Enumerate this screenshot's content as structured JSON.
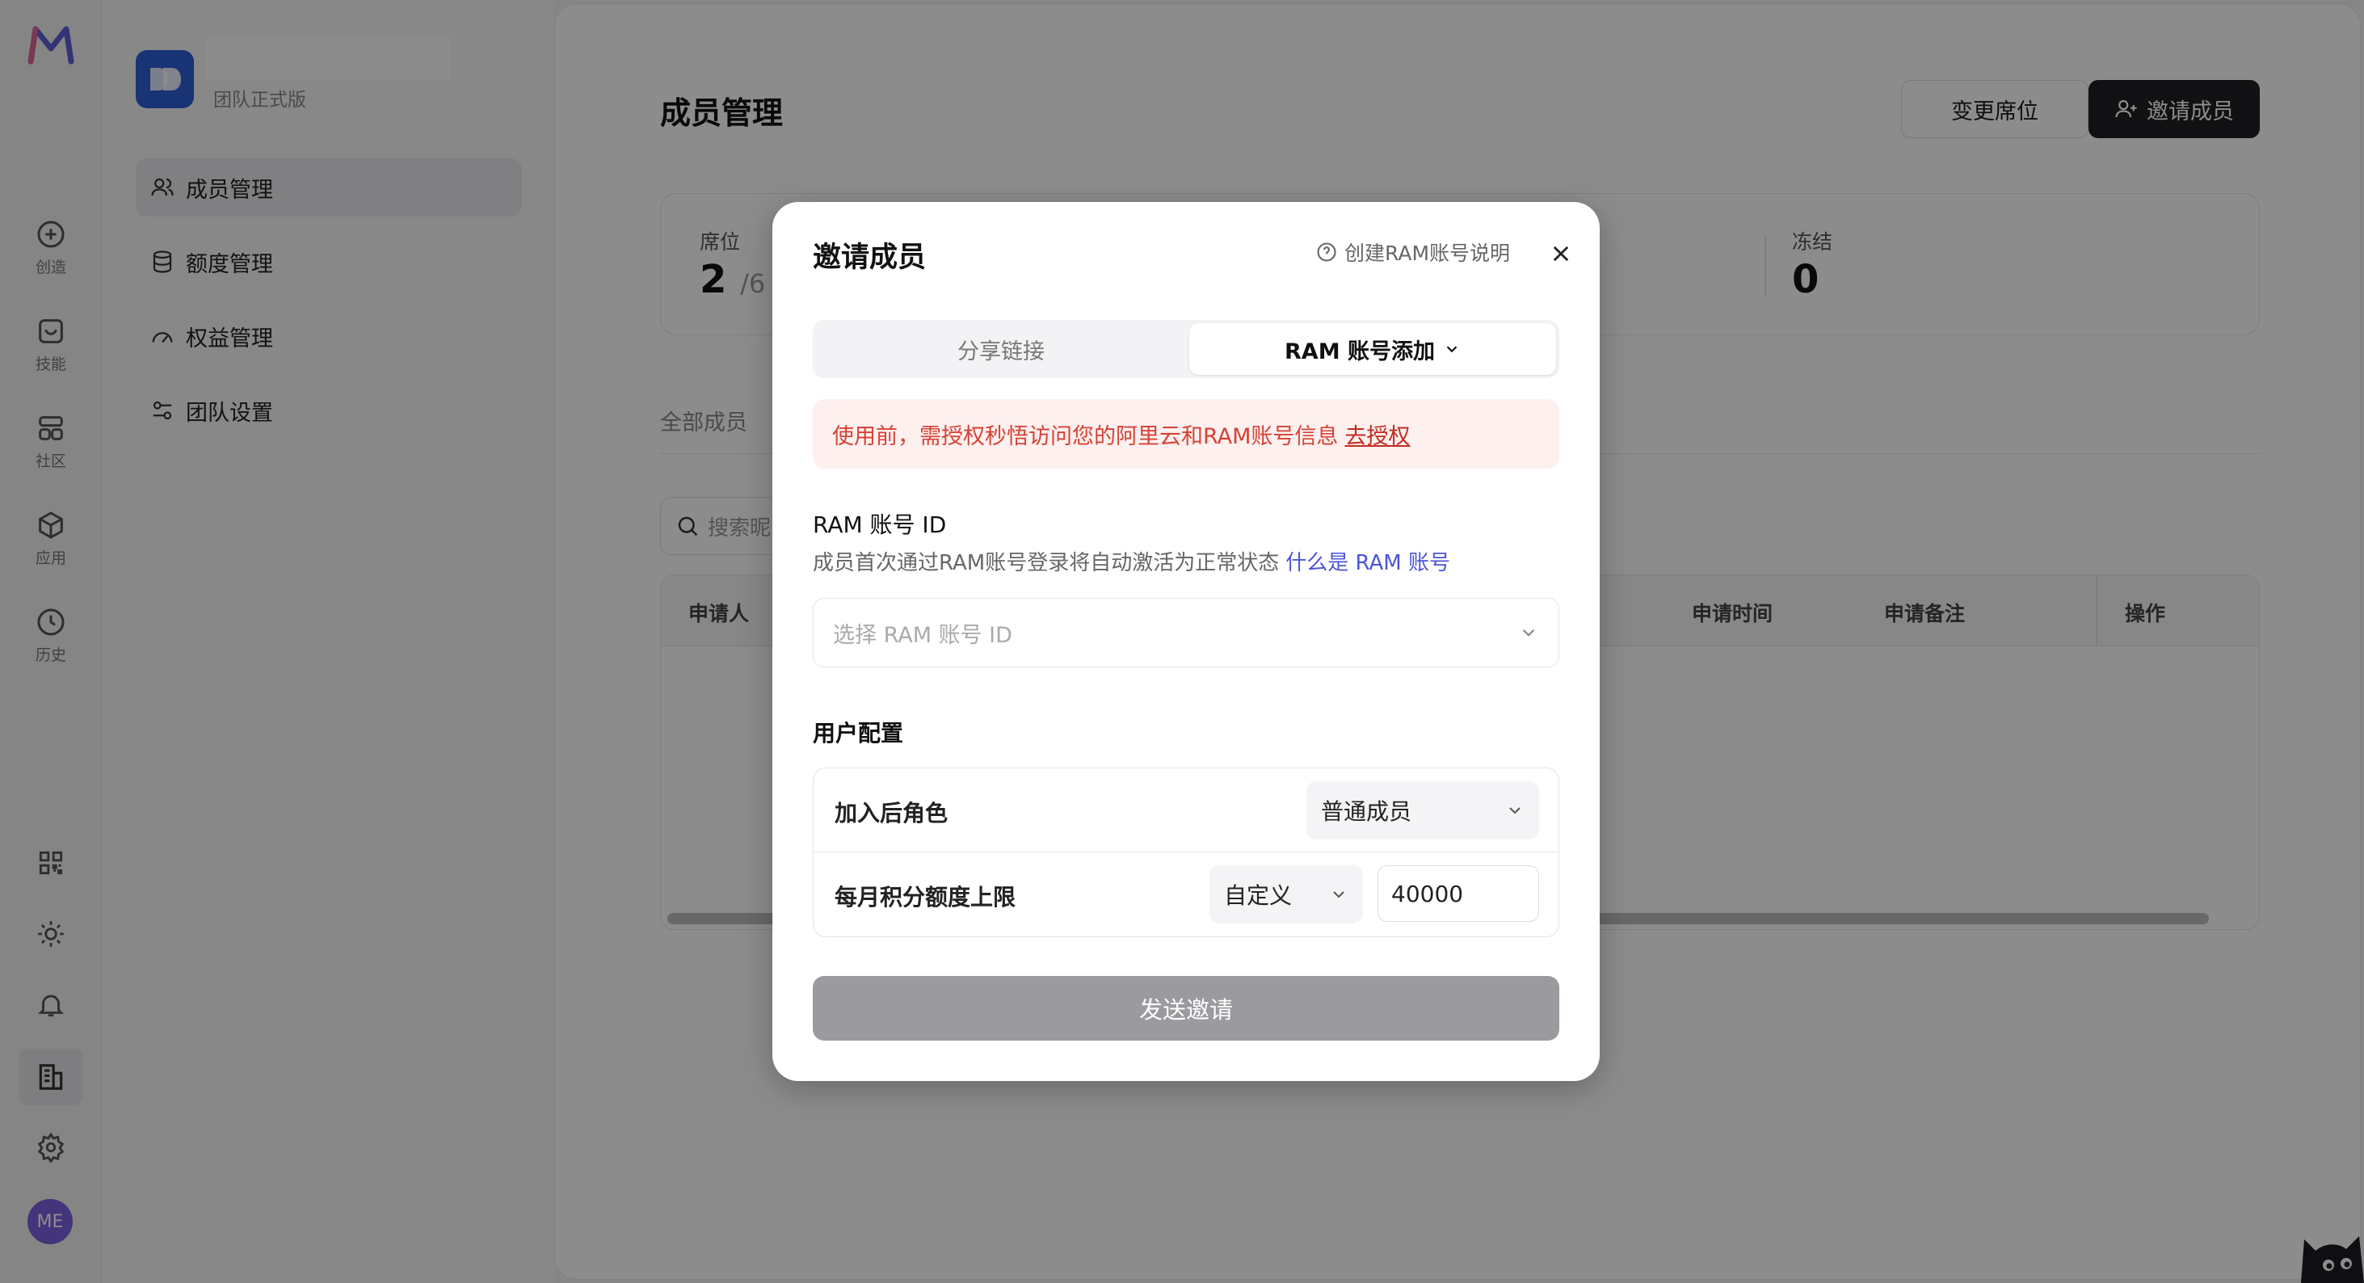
{
  "rail": {
    "items": [
      {
        "label": "创造",
        "icon": "plus-circle-icon"
      },
      {
        "label": "技能",
        "icon": "inbox-icon"
      },
      {
        "label": "社区",
        "icon": "grid-icon"
      },
      {
        "label": "应用",
        "icon": "cube-icon"
      },
      {
        "label": "历史",
        "icon": "clock-icon"
      }
    ],
    "avatar": "ME"
  },
  "sidebar": {
    "team_plan": "团队正式版",
    "items": [
      {
        "label": "成员管理",
        "icon": "users-icon"
      },
      {
        "label": "额度管理",
        "icon": "database-icon"
      },
      {
        "label": "权益管理",
        "icon": "gauge-icon"
      },
      {
        "label": "团队设置",
        "icon": "sliders-icon"
      }
    ]
  },
  "main": {
    "title": "成员管理",
    "change_seats": "变更席位",
    "invite_member": "邀请成员",
    "stats": {
      "seats_label": "席位",
      "seats_value": "2",
      "seats_total": "/6",
      "frozen_label": "冻结",
      "frozen_value": "0"
    },
    "tab_all": "全部成员",
    "search_placeholder": "搜索昵",
    "table_headers": [
      "申请人",
      "申请时间",
      "申请备注",
      "操作"
    ]
  },
  "modal": {
    "title": "邀请成员",
    "help_link": "创建RAM账号说明",
    "tabs": {
      "share": "分享链接",
      "ram": "RAM 账号添加"
    },
    "alert_text": "使用前，需授权秒悟访问您的阿里云和RAM账号信息",
    "alert_link": "去授权",
    "ram_label": "RAM 账号 ID",
    "ram_desc": "成员首次通过RAM账号登录将自动激活为正常状态",
    "ram_link": "什么是 RAM 账号",
    "ram_placeholder": "选择 RAM 账号 ID",
    "config_title": "用户配置",
    "role_label": "加入后角色",
    "role_value": "普通成员",
    "quota_label": "每月积分额度上限",
    "quota_mode": "自定义",
    "quota_value": "40000",
    "send_button": "发送邀请"
  },
  "colors": {
    "accent": "#4a55d8",
    "alert_text": "#d64235",
    "alert_bg": "#fdf0ef",
    "dark_button": "#1f1f24",
    "send_disabled": "#9b9b9f"
  }
}
